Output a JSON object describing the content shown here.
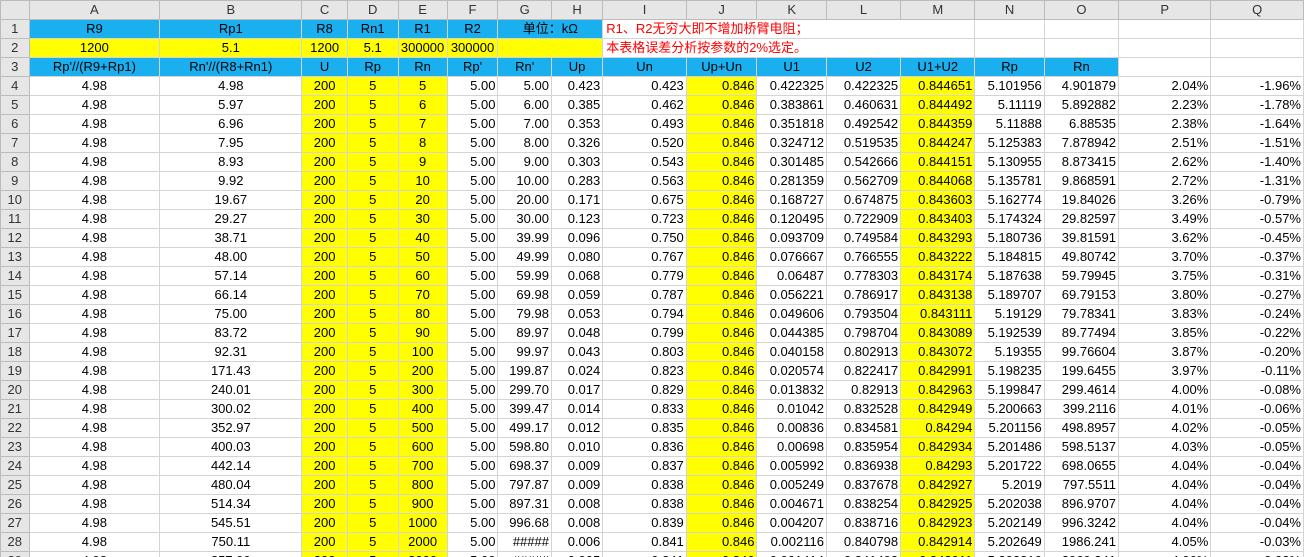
{
  "columns": [
    "A",
    "B",
    "C",
    "D",
    "E",
    "F",
    "G",
    "H",
    "I",
    "J",
    "K",
    "L",
    "M",
    "N",
    "O",
    "P",
    "Q"
  ],
  "row_numbers": [
    "1",
    "2",
    "3",
    "4",
    "5",
    "6",
    "7",
    "8",
    "9",
    "10",
    "11",
    "12",
    "13",
    "14",
    "15",
    "16",
    "17",
    "18",
    "19",
    "20",
    "21",
    "22",
    "23",
    "24",
    "25",
    "26",
    "27",
    "28",
    "29"
  ],
  "row1": {
    "A": "R9",
    "B": "Rp1",
    "C": "R8",
    "D": "Rn1",
    "E": "R1",
    "F": "R2",
    "GH": "单位：kΩ",
    "note1": "R1、R2无穷大即不增加桥臂电阻；"
  },
  "row2": {
    "A": "1200",
    "B": "5.1",
    "C": "1200",
    "D": "5.1",
    "E": "300000",
    "F": "300000",
    "note2": "本表格误差分析按参数的2%选定。"
  },
  "row3": {
    "A": "Rp'//(R9+Rp1)",
    "B": "Rn'//(R8+Rn1)",
    "C": "U",
    "D": "Rp",
    "E": "Rn",
    "F": "Rp'",
    "G": "Rn'",
    "H": "Up",
    "I": "Un",
    "J": "Up+Un",
    "K": "U1",
    "L": "U2",
    "M": "U1+U2",
    "N": "Rp",
    "O": "Rn"
  },
  "rows": [
    [
      "4.98",
      "4.98",
      "200",
      "5",
      "5",
      "5.00",
      "5.00",
      "0.423",
      "0.423",
      "0.846",
      "0.422325",
      "0.422325",
      "0.844651",
      "5.101956",
      "4.901879",
      "2.04%",
      "-1.96%"
    ],
    [
      "4.98",
      "5.97",
      "200",
      "5",
      "6",
      "5.00",
      "6.00",
      "0.385",
      "0.462",
      "0.846",
      "0.383861",
      "0.460631",
      "0.844492",
      "5.11119",
      "5.892882",
      "2.23%",
      "-1.78%"
    ],
    [
      "4.98",
      "6.96",
      "200",
      "5",
      "7",
      "5.00",
      "7.00",
      "0.353",
      "0.493",
      "0.846",
      "0.351818",
      "0.492542",
      "0.844359",
      "5.11888",
      "6.88535",
      "2.38%",
      "-1.64%"
    ],
    [
      "4.98",
      "7.95",
      "200",
      "5",
      "8",
      "5.00",
      "8.00",
      "0.326",
      "0.520",
      "0.846",
      "0.324712",
      "0.519535",
      "0.844247",
      "5.125383",
      "7.878942",
      "2.51%",
      "-1.51%"
    ],
    [
      "4.98",
      "8.93",
      "200",
      "5",
      "9",
      "5.00",
      "9.00",
      "0.303",
      "0.543",
      "0.846",
      "0.301485",
      "0.542666",
      "0.844151",
      "5.130955",
      "8.873415",
      "2.62%",
      "-1.40%"
    ],
    [
      "4.98",
      "9.92",
      "200",
      "5",
      "10",
      "5.00",
      "10.00",
      "0.283",
      "0.563",
      "0.846",
      "0.281359",
      "0.562709",
      "0.844068",
      "5.135781",
      "9.868591",
      "2.72%",
      "-1.31%"
    ],
    [
      "4.98",
      "19.67",
      "200",
      "5",
      "20",
      "5.00",
      "20.00",
      "0.171",
      "0.675",
      "0.846",
      "0.168727",
      "0.674875",
      "0.843603",
      "5.162774",
      "19.84026",
      "3.26%",
      "-0.79%"
    ],
    [
      "4.98",
      "29.27",
      "200",
      "5",
      "30",
      "5.00",
      "30.00",
      "0.123",
      "0.723",
      "0.846",
      "0.120495",
      "0.722909",
      "0.843403",
      "5.174324",
      "29.82597",
      "3.49%",
      "-0.57%"
    ],
    [
      "4.98",
      "38.71",
      "200",
      "5",
      "40",
      "5.00",
      "39.99",
      "0.096",
      "0.750",
      "0.846",
      "0.093709",
      "0.749584",
      "0.843293",
      "5.180736",
      "39.81591",
      "3.62%",
      "-0.45%"
    ],
    [
      "4.98",
      "48.00",
      "200",
      "5",
      "50",
      "5.00",
      "49.99",
      "0.080",
      "0.767",
      "0.846",
      "0.076667",
      "0.766555",
      "0.843222",
      "5.184815",
      "49.80742",
      "3.70%",
      "-0.37%"
    ],
    [
      "4.98",
      "57.14",
      "200",
      "5",
      "60",
      "5.00",
      "59.99",
      "0.068",
      "0.779",
      "0.846",
      "0.06487",
      "0.778303",
      "0.843174",
      "5.187638",
      "59.79945",
      "3.75%",
      "-0.31%"
    ],
    [
      "4.98",
      "66.14",
      "200",
      "5",
      "70",
      "5.00",
      "69.98",
      "0.059",
      "0.787",
      "0.846",
      "0.056221",
      "0.786917",
      "0.843138",
      "5.189707",
      "69.79153",
      "3.80%",
      "-0.27%"
    ],
    [
      "4.98",
      "75.00",
      "200",
      "5",
      "80",
      "5.00",
      "79.98",
      "0.053",
      "0.794",
      "0.846",
      "0.049606",
      "0.793504",
      "0.843111",
      "5.19129",
      "79.78341",
      "3.83%",
      "-0.24%"
    ],
    [
      "4.98",
      "83.72",
      "200",
      "5",
      "90",
      "5.00",
      "89.97",
      "0.048",
      "0.799",
      "0.846",
      "0.044385",
      "0.798704",
      "0.843089",
      "5.192539",
      "89.77494",
      "3.85%",
      "-0.22%"
    ],
    [
      "4.98",
      "92.31",
      "200",
      "5",
      "100",
      "5.00",
      "99.97",
      "0.043",
      "0.803",
      "0.846",
      "0.040158",
      "0.802913",
      "0.843072",
      "5.19355",
      "99.76604",
      "3.87%",
      "-0.20%"
    ],
    [
      "4.98",
      "171.43",
      "200",
      "5",
      "200",
      "5.00",
      "199.87",
      "0.024",
      "0.823",
      "0.846",
      "0.020574",
      "0.822417",
      "0.842991",
      "5.198235",
      "199.6455",
      "3.97%",
      "-0.11%"
    ],
    [
      "4.98",
      "240.01",
      "200",
      "5",
      "300",
      "5.00",
      "299.70",
      "0.017",
      "0.829",
      "0.846",
      "0.013832",
      "0.82913",
      "0.842963",
      "5.199847",
      "299.4614",
      "4.00%",
      "-0.08%"
    ],
    [
      "4.98",
      "300.02",
      "200",
      "5",
      "400",
      "5.00",
      "399.47",
      "0.014",
      "0.833",
      "0.846",
      "0.01042",
      "0.832528",
      "0.842949",
      "5.200663",
      "399.2116",
      "4.01%",
      "-0.06%"
    ],
    [
      "4.98",
      "352.97",
      "200",
      "5",
      "500",
      "5.00",
      "499.17",
      "0.012",
      "0.835",
      "0.846",
      "0.00836",
      "0.834581",
      "0.84294",
      "5.201156",
      "498.8957",
      "4.02%",
      "-0.05%"
    ],
    [
      "4.98",
      "400.03",
      "200",
      "5",
      "600",
      "5.00",
      "598.80",
      "0.010",
      "0.836",
      "0.846",
      "0.00698",
      "0.835954",
      "0.842934",
      "5.201486",
      "598.5137",
      "4.03%",
      "-0.05%"
    ],
    [
      "4.98",
      "442.14",
      "200",
      "5",
      "700",
      "5.00",
      "698.37",
      "0.009",
      "0.837",
      "0.846",
      "0.005992",
      "0.836938",
      "0.84293",
      "5.201722",
      "698.0655",
      "4.04%",
      "-0.04%"
    ],
    [
      "4.98",
      "480.04",
      "200",
      "5",
      "800",
      "5.00",
      "797.87",
      "0.009",
      "0.838",
      "0.846",
      "0.005249",
      "0.837678",
      "0.842927",
      "5.2019",
      "797.5511",
      "4.04%",
      "-0.04%"
    ],
    [
      "4.98",
      "514.34",
      "200",
      "5",
      "900",
      "5.00",
      "897.31",
      "0.008",
      "0.838",
      "0.846",
      "0.004671",
      "0.838254",
      "0.842925",
      "5.202038",
      "896.9707",
      "4.04%",
      "-0.04%"
    ],
    [
      "4.98",
      "545.51",
      "200",
      "5",
      "1000",
      "5.00",
      "996.68",
      "0.008",
      "0.839",
      "0.846",
      "0.004207",
      "0.838716",
      "0.842923",
      "5.202149",
      "996.3242",
      "4.04%",
      "-0.04%"
    ],
    [
      "4.98",
      "750.11",
      "200",
      "5",
      "2000",
      "5.00",
      "#####",
      "0.006",
      "0.841",
      "0.846",
      "0.002116",
      "0.840798",
      "0.842914",
      "5.202649",
      "1986.241",
      "4.05%",
      "-0.03%"
    ],
    [
      "4.98",
      "857.99",
      "200",
      "5",
      "3000",
      "5.00",
      "#####",
      "0.005",
      "0.841",
      "0.846",
      "0.001414",
      "0.841493",
      "0.842911",
      "5.202816",
      "2969.341",
      "4.06%",
      "-0.02%"
    ]
  ],
  "colors": {
    "header_blue": "#1ab0f0",
    "highlight_yellow": "#ffff00",
    "note_red": "#ff0000",
    "header_gray": "#e6e6e6"
  }
}
